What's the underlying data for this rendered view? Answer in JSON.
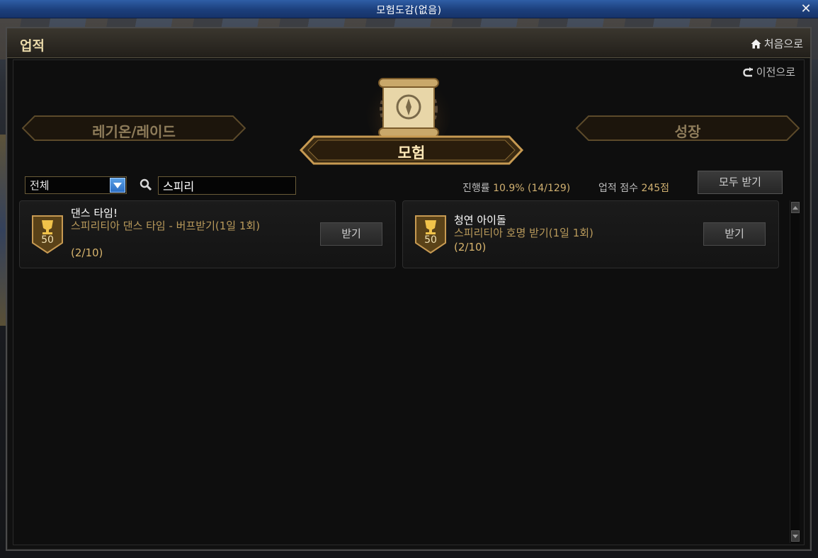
{
  "window": {
    "title": "모험도감(없음)",
    "close_glyph": "✕"
  },
  "header": {
    "title": "업적",
    "home_label": "처음으로",
    "back_label": "이전으로"
  },
  "categories": {
    "left": "레기온/레이드",
    "center": "모험",
    "right": "성장"
  },
  "filter": {
    "selected": "전체",
    "search_value": "스피리"
  },
  "stats": {
    "progress_label": "진행률",
    "progress_value": "10.9% (14/129)",
    "score_label": "업적 점수",
    "score_value": "245점"
  },
  "claim_all_label": "모두 받기",
  "achievements": [
    {
      "points": "50",
      "name": "댄스 타임!",
      "desc": "스피리티아 댄스 타임 - 버프받기(1일 1회)",
      "progress": "(2/10)",
      "claim_label": "받기"
    },
    {
      "points": "50",
      "name": "청연 아이돌",
      "desc": "스피리티아 호명 받기(1일 1회)",
      "progress": "(2/10)",
      "claim_label": "받기"
    }
  ],
  "colors": {
    "gold": "#d0b070",
    "title_bar": "#1c3f7c",
    "accent_blue": "#2d6fc4"
  },
  "icons": [
    "close-icon",
    "home-icon",
    "back-arrow-icon",
    "scroll-emblem-icon",
    "dropdown-arrow-icon",
    "search-icon",
    "trophy-icon"
  ]
}
